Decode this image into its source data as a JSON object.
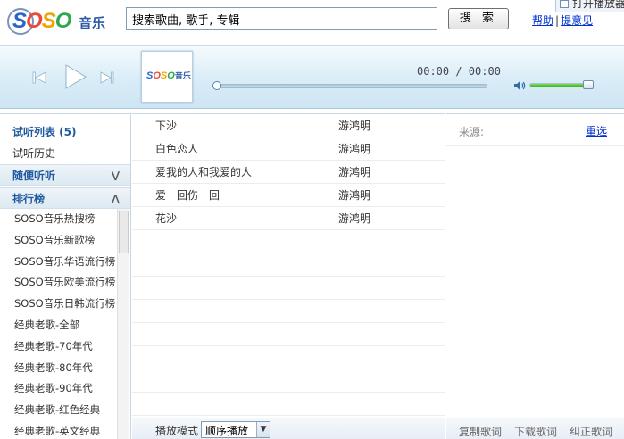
{
  "brand": {
    "logo_letters": [
      "S",
      "O",
      "S",
      "O"
    ],
    "logo_suffix": "音乐",
    "colors": {
      "s1": "#2a66c9",
      "o1": "#e84b3c",
      "s2": "#f2a300",
      "o2": "#2fa84f"
    }
  },
  "header": {
    "search_value": "搜索歌曲, 歌手, 专辑",
    "search_button": "搜 索",
    "help_link": "帮助",
    "feedback_link": "提意见",
    "open_player": "打开播放器"
  },
  "player": {
    "time_display": "00:00 / 00:00",
    "progress": 0,
    "volume": 1.0,
    "icons": [
      "previous-icon",
      "play-icon",
      "next-icon",
      "volume-icon"
    ]
  },
  "sidebar": {
    "playlist_title": "试听列表 (5)",
    "history": "试听历史",
    "random_listen": "随便听听",
    "charts_title": "排行榜",
    "charts": [
      "SOSO音乐热搜榜",
      "SOSO音乐新歌榜",
      "SOSO音乐华语流行榜",
      "SOSO音乐欧美流行榜",
      "SOSO音乐日韩流行榜",
      "经典老歌-全部",
      "经典老歌-70年代",
      "经典老歌-80年代",
      "经典老歌-90年代",
      "经典老歌-红色经典",
      "经典老歌-英文经典"
    ]
  },
  "songs": [
    {
      "title": "下沙",
      "artist": "游鸿明"
    },
    {
      "title": "白色恋人",
      "artist": "游鸿明"
    },
    {
      "title": "爱我的人和我爱的人",
      "artist": "游鸿明"
    },
    {
      "title": "爱一回伤一回",
      "artist": "游鸿明"
    },
    {
      "title": "花沙",
      "artist": "游鸿明"
    }
  ],
  "playback": {
    "mode_label": "播放模式",
    "mode_value": "顺序播放"
  },
  "lyrics": {
    "source_label": "来源:",
    "reselect": "重选",
    "copy": "复制歌词",
    "download": "下载歌词",
    "correct": "纠正歌词"
  }
}
